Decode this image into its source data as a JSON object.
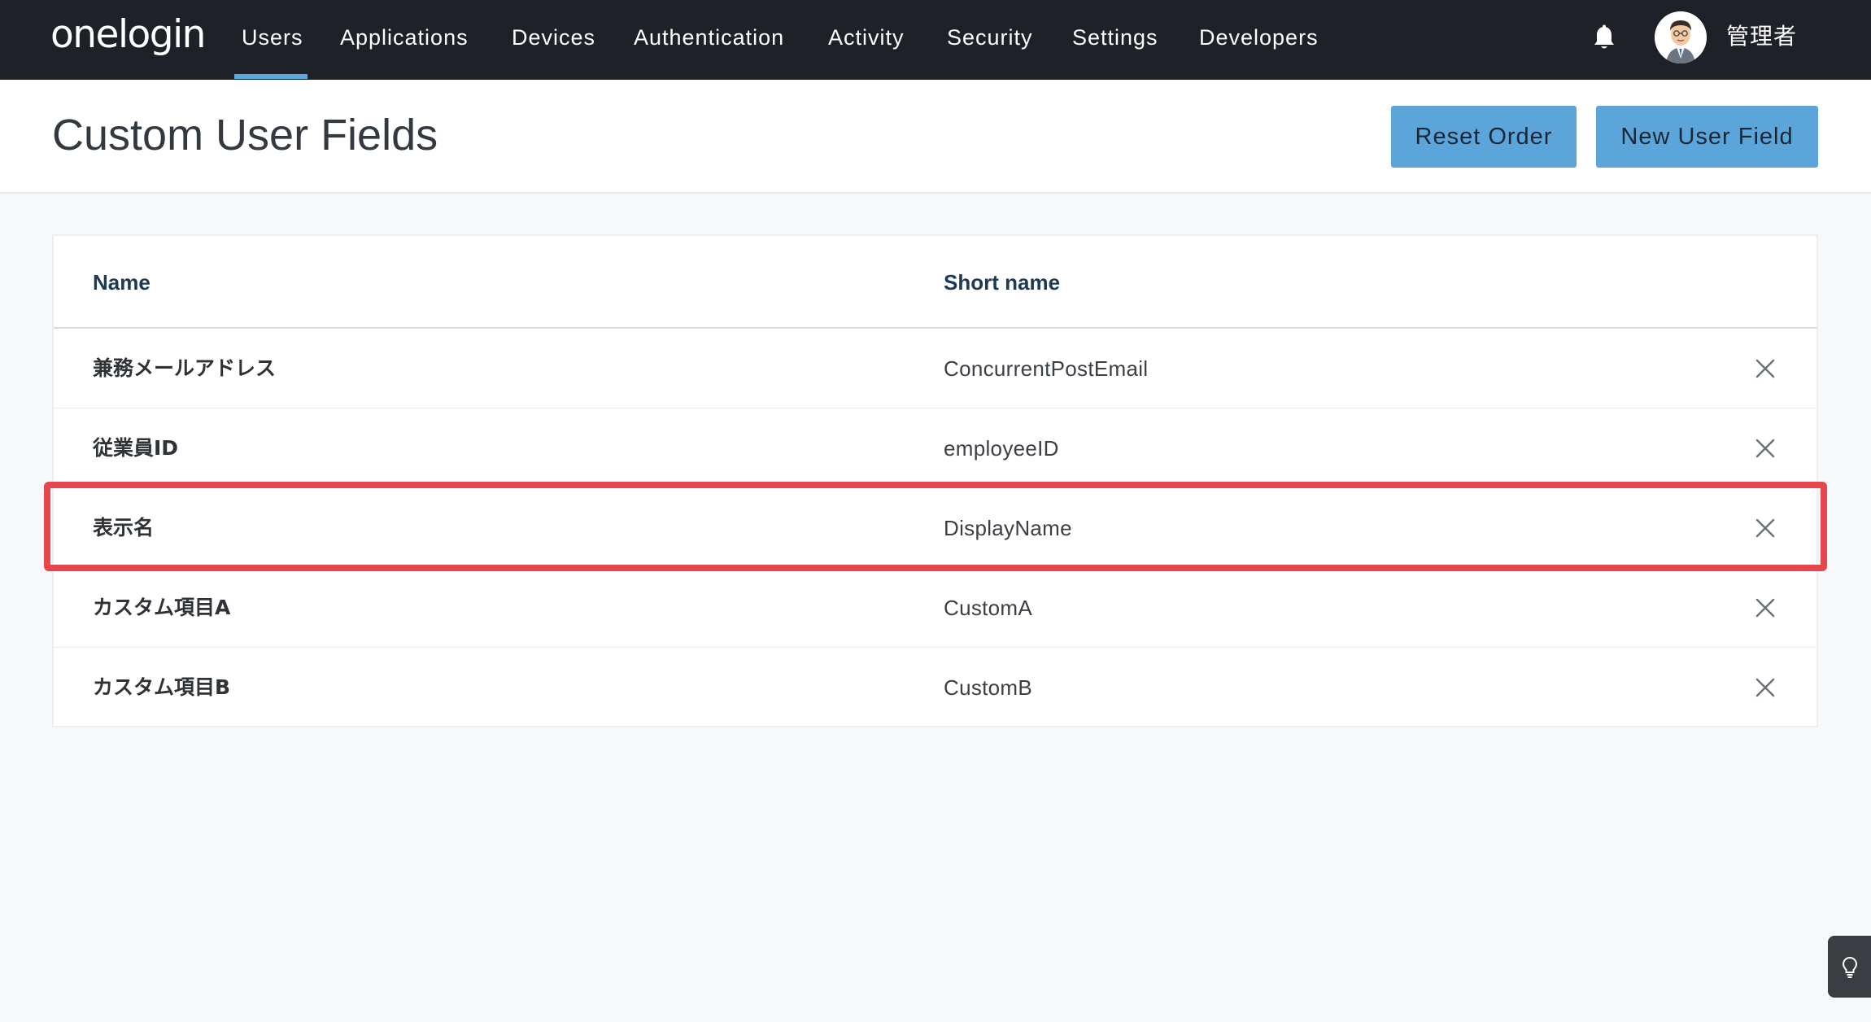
{
  "brand": {
    "logo_text": "onelogin"
  },
  "nav": {
    "items": [
      {
        "label": "Users",
        "active": true
      },
      {
        "label": "Applications"
      },
      {
        "label": "Devices"
      },
      {
        "label": "Authentication"
      },
      {
        "label": "Activity"
      },
      {
        "label": "Security"
      },
      {
        "label": "Settings"
      },
      {
        "label": "Developers"
      }
    ],
    "user_name": "管理者",
    "notification_icon": "bell-icon",
    "avatar_icon": "user-avatar"
  },
  "page": {
    "title": "Custom User Fields",
    "buttons": {
      "reset_order": "Reset Order",
      "new_user_field": "New User Field"
    }
  },
  "table": {
    "columns": [
      "Name",
      "Short name"
    ],
    "rows": [
      {
        "name": "兼務メールアドレス",
        "short_name": "ConcurrentPostEmail"
      },
      {
        "name": "従業員ID",
        "short_name": "employeeID"
      },
      {
        "name": "表示名",
        "short_name": "DisplayName",
        "highlighted": true
      },
      {
        "name": "カスタム項目A",
        "short_name": "CustomA"
      },
      {
        "name": "カスタム項目B",
        "short_name": "CustomB"
      }
    ],
    "row_action_icon": "close-icon"
  },
  "colors": {
    "nav_bg": "#1f2128",
    "accent": "#5ba5db",
    "active_underline": "#5aa9dd",
    "highlight": "#e5474d",
    "page_bg": "#f7f8f9"
  },
  "widgets": {
    "tip_icon": "lightbulb-icon"
  }
}
